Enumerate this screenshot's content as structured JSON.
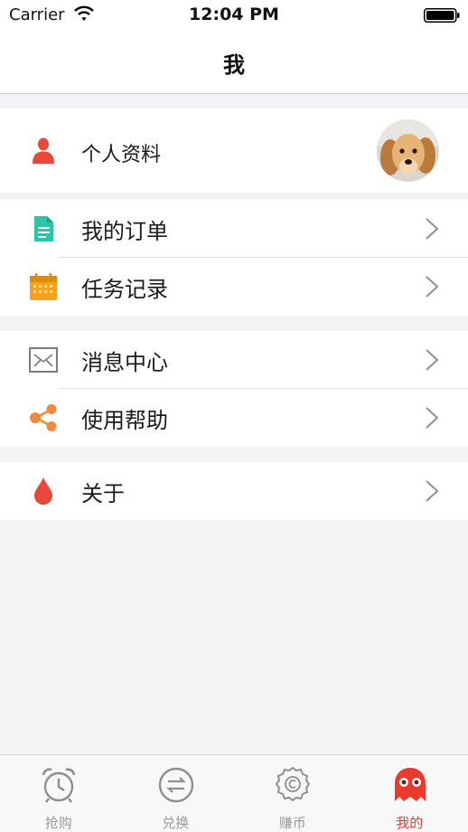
{
  "status_bar": {
    "carrier": "Carrier",
    "time": "12:04 PM"
  },
  "nav": {
    "title": "我"
  },
  "profile": {
    "label": "个人资料"
  },
  "menu": {
    "orders": "我的订单",
    "tasks": "任务记录",
    "messages": "消息中心",
    "help": "使用帮助",
    "about": "关于"
  },
  "tabs": [
    {
      "label": "抢购",
      "icon": "alarm-clock-icon"
    },
    {
      "label": "兑换",
      "icon": "exchange-icon"
    },
    {
      "label": "赚币",
      "icon": "coin-badge-icon"
    },
    {
      "label": "我的",
      "icon": "ghost-icon"
    }
  ],
  "colors": {
    "accent_red": "#e93a2e",
    "teal": "#2ec4a6",
    "orange": "#f7a21b",
    "share_orange": "#f08a3c",
    "tab_inactive": "#9a9a9a"
  }
}
